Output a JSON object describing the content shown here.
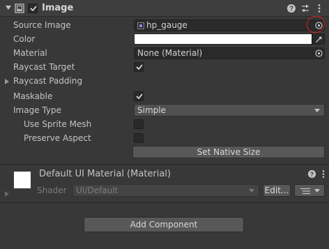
{
  "component": {
    "title": "Image",
    "enabled": true
  },
  "properties": {
    "source_image_label": "Source Image",
    "source_image_value": "hp_gauge",
    "color_label": "Color",
    "color_value": "#ffffff",
    "material_label": "Material",
    "material_value": "None (Material)",
    "raycast_target_label": "Raycast Target",
    "raycast_target_checked": true,
    "raycast_padding_label": "Raycast Padding",
    "maskable_label": "Maskable",
    "maskable_checked": true,
    "image_type_label": "Image Type",
    "image_type_value": "Simple",
    "use_sprite_mesh_label": "Use Sprite Mesh",
    "use_sprite_mesh_checked": false,
    "preserve_aspect_label": "Preserve Aspect",
    "preserve_aspect_checked": false,
    "set_native_size_label": "Set Native Size"
  },
  "material_section": {
    "title": "Default UI Material (Material)",
    "shader_label": "Shader",
    "shader_value": "UI/Default",
    "edit_button_label": "Edit..."
  },
  "footer": {
    "add_component_label": "Add Component"
  },
  "colors": {
    "background": "#383838",
    "annotation": "#e02020"
  }
}
